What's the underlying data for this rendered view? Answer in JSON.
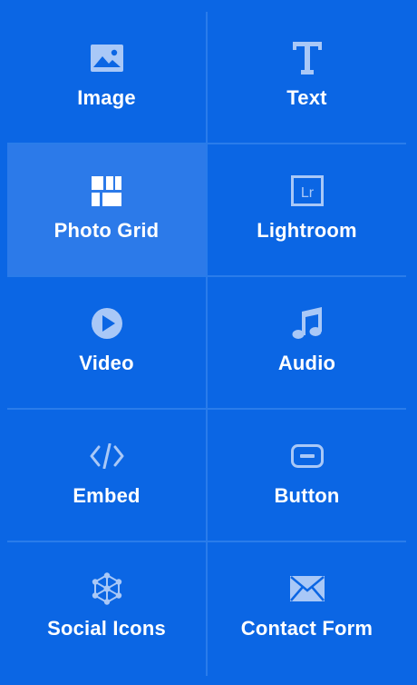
{
  "colors": {
    "background": "#0b66e4",
    "divider": "#2a7cea",
    "selected_tile": "#2c7ae9",
    "icon_muted": "#a9c8f7",
    "icon_active": "#ffffff",
    "label": "#ffffff"
  },
  "tiles": [
    {
      "label": "Image",
      "icon": "image-icon",
      "selected": false
    },
    {
      "label": "Text",
      "icon": "text-icon",
      "selected": false
    },
    {
      "label": "Photo Grid",
      "icon": "photo-grid-icon",
      "selected": true
    },
    {
      "label": "Lightroom",
      "icon": "lightroom-icon",
      "selected": false,
      "icon_text": "Lr"
    },
    {
      "label": "Video",
      "icon": "video-play-icon",
      "selected": false
    },
    {
      "label": "Audio",
      "icon": "music-note-icon",
      "selected": false
    },
    {
      "label": "Embed",
      "icon": "code-icon",
      "selected": false
    },
    {
      "label": "Button",
      "icon": "button-icon",
      "selected": false
    },
    {
      "label": "Social Icons",
      "icon": "social-network-icon",
      "selected": false
    },
    {
      "label": "Contact Form",
      "icon": "envelope-icon",
      "selected": false
    }
  ]
}
